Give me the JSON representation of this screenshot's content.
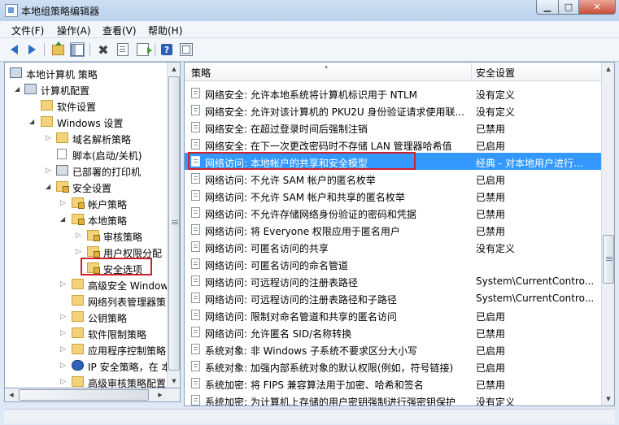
{
  "window": {
    "title": "本地组策略编辑器"
  },
  "menu": [
    "文件(F)",
    "操作(A)",
    "查看(V)",
    "帮助(H)"
  ],
  "tree": [
    {
      "label": "本地计算机 策略",
      "icon": "computer-icon",
      "expander": "none"
    },
    {
      "label": "计算机配置",
      "icon": "computer-config-icon",
      "expander": "open"
    },
    {
      "label": "软件设置",
      "icon": "folder-icon",
      "expander": "none"
    },
    {
      "label": "Windows 设置",
      "icon": "folder-icon",
      "expander": "open"
    },
    {
      "label": "域名解析策略",
      "icon": "folder-icon",
      "expander": "closed"
    },
    {
      "label": "脚本(启动/关机)",
      "icon": "script-icon",
      "expander": "none"
    },
    {
      "label": "已部署的打印机",
      "icon": "printer-icon",
      "expander": "closed"
    },
    {
      "label": "安全设置",
      "icon": "security-folder-icon",
      "expander": "open"
    },
    {
      "label": "帐户策略",
      "icon": "security-folder-icon",
      "expander": "closed"
    },
    {
      "label": "本地策略",
      "icon": "security-folder-icon",
      "expander": "open"
    },
    {
      "label": "审核策略",
      "icon": "security-folder-icon",
      "expander": "closed"
    },
    {
      "label": "用户权限分配",
      "icon": "security-folder-icon",
      "expander": "closed"
    },
    {
      "label": "安全选项",
      "icon": "security-folder-icon",
      "expander": "none"
    },
    {
      "label": "高级安全 Window",
      "icon": "folder-icon",
      "expander": "closed"
    },
    {
      "label": "网络列表管理器策",
      "icon": "folder-icon",
      "expander": "none"
    },
    {
      "label": "公钥策略",
      "icon": "folder-icon",
      "expander": "closed"
    },
    {
      "label": "软件限制策略",
      "icon": "folder-icon",
      "expander": "closed"
    },
    {
      "label": "应用程序控制策略",
      "icon": "folder-icon",
      "expander": "closed"
    },
    {
      "label": "IP 安全策略，在 本",
      "icon": "ip-security-icon",
      "expander": "closed"
    },
    {
      "label": "高级审核策略配置",
      "icon": "folder-icon",
      "expander": "closed"
    }
  ],
  "list": {
    "columns": [
      "策略",
      "安全设置"
    ],
    "rows": [
      {
        "policy": "网络安全: 允许本地系统将计算机标识用于 NTLM",
        "setting": "没有定义"
      },
      {
        "policy": "网络安全: 允许对该计算机的 PKU2U 身份验证请求使用联...",
        "setting": "没有定义"
      },
      {
        "policy": "网络安全: 在超过登录时间后强制注销",
        "setting": "已禁用"
      },
      {
        "policy": "网络安全: 在下一次更改密码时不存储 LAN 管理器哈希值",
        "setting": "已启用"
      },
      {
        "policy": "网络访问: 本地帐户的共享和安全模型",
        "setting": "经典 - 对本地用户进行..."
      },
      {
        "policy": "网络访问: 不允许 SAM 帐户的匿名枚举",
        "setting": "已启用"
      },
      {
        "policy": "网络访问: 不允许 SAM 帐户和共享的匿名枚举",
        "setting": "已禁用"
      },
      {
        "policy": "网络访问: 不允许存储网络身份验证的密码和凭据",
        "setting": "已禁用"
      },
      {
        "policy": "网络访问: 将 Everyone 权限应用于匿名用户",
        "setting": "已禁用"
      },
      {
        "policy": "网络访问: 可匿名访问的共享",
        "setting": "没有定义"
      },
      {
        "policy": "网络访问: 可匿名访问的命名管道",
        "setting": ""
      },
      {
        "policy": "网络访问: 可远程访问的注册表路径",
        "setting": "System\\CurrentContro..."
      },
      {
        "policy": "网络访问: 可远程访问的注册表路径和子路径",
        "setting": "System\\CurrentContro..."
      },
      {
        "policy": "网络访问: 限制对命名管道和共享的匿名访问",
        "setting": "已启用"
      },
      {
        "policy": "网络访问: 允许匿名 SID/名称转换",
        "setting": "已禁用"
      },
      {
        "policy": "系统对象: 非 Windows 子系统不要求区分大小写",
        "setting": "已启用"
      },
      {
        "policy": "系统对象: 加强内部系统对象的默认权限(例如，符号链接)",
        "setting": "已启用"
      },
      {
        "policy": "系统加密: 将 FIPS 兼容算法用于加密、哈希和签名",
        "setting": "已禁用"
      },
      {
        "policy": "系统加密: 为计算机上存储的用户密钥强制进行强密钥保护",
        "setting": "没有定义"
      }
    ],
    "selected_index": 4
  },
  "colors": {
    "selection": "#3399ff",
    "highlight_box": "#d0202a"
  }
}
